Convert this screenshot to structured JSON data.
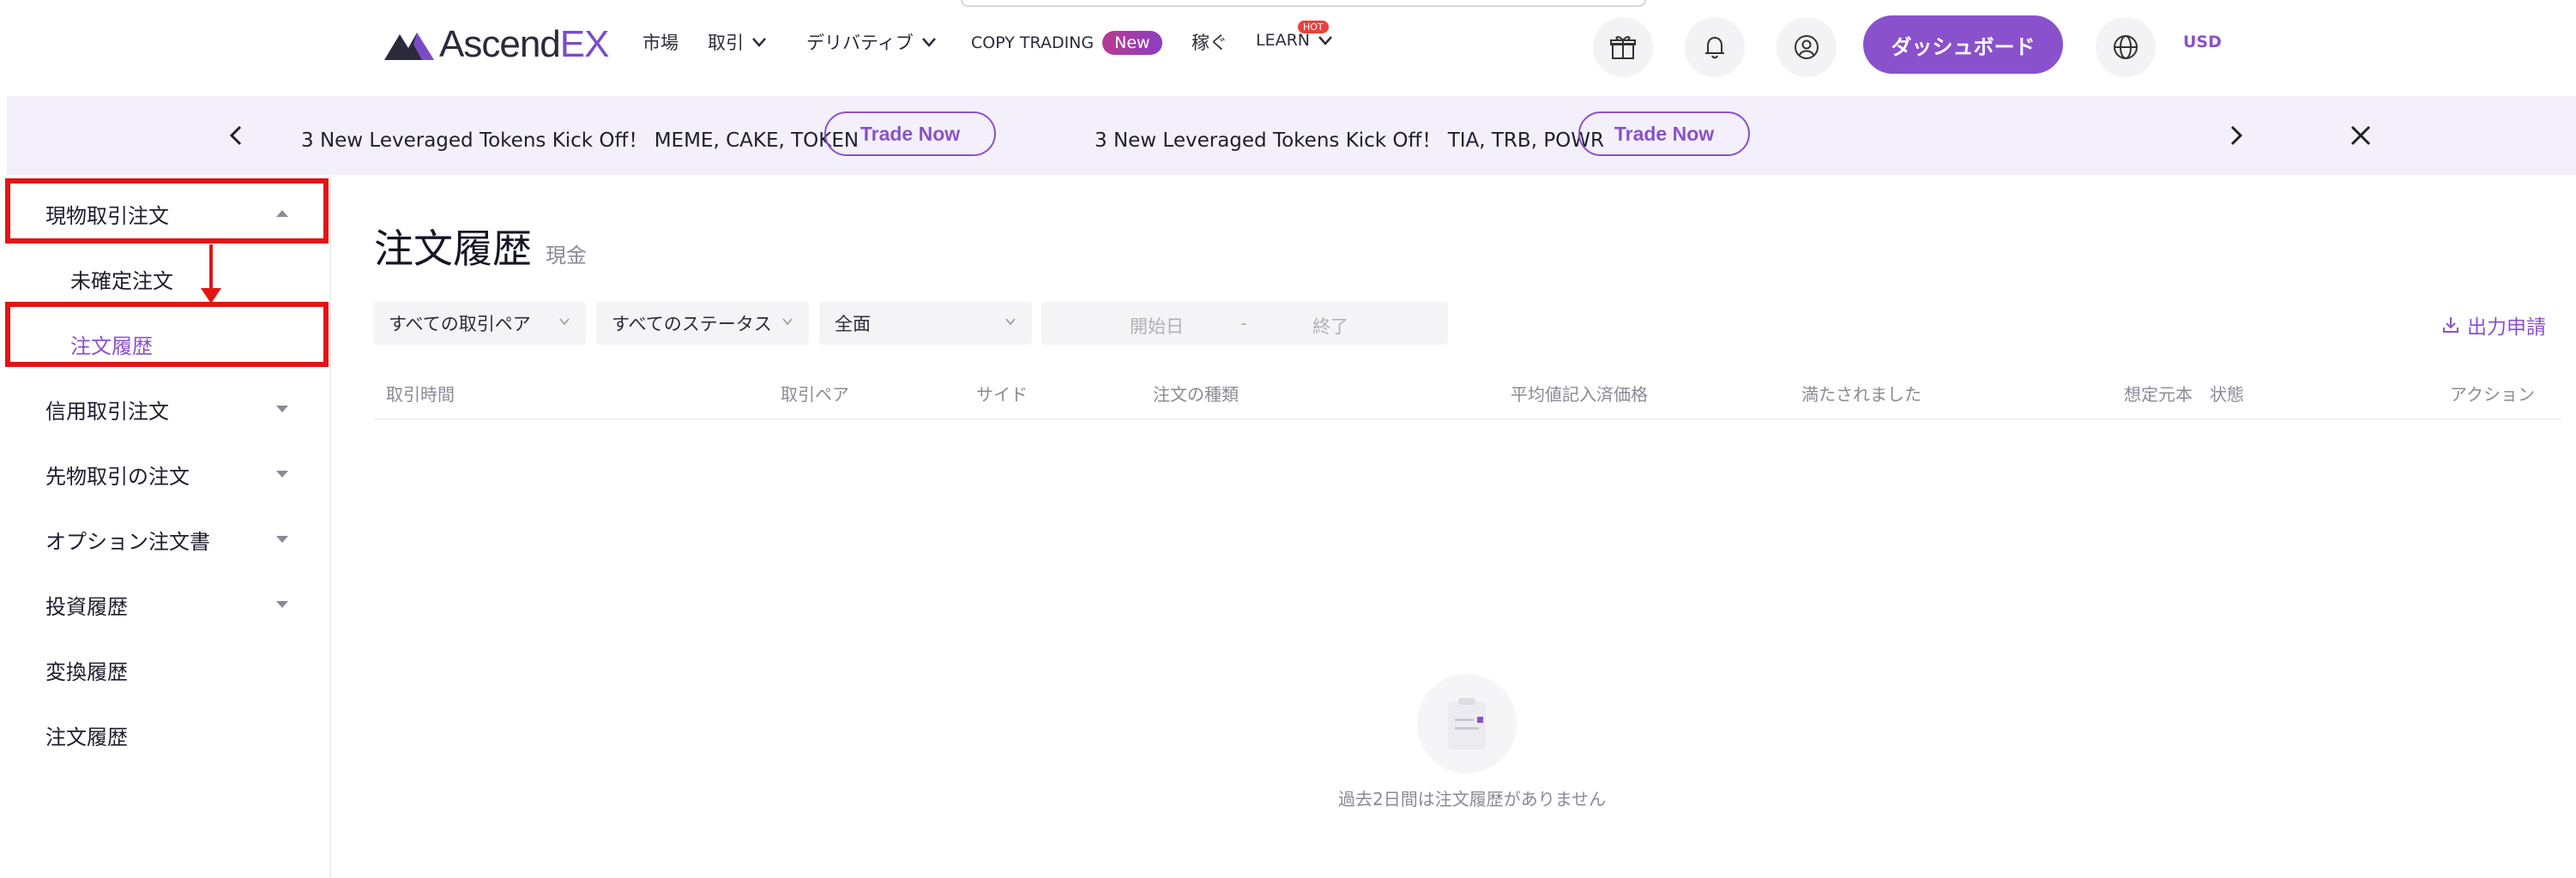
{
  "header": {
    "logo_text_main": "Ascend",
    "logo_text_accent": "EX",
    "nav": {
      "market": "市場",
      "trade": "取引",
      "derivatives": "デリバティブ",
      "copy_trading": "COPY TRADING",
      "new_badge": "New",
      "earn": "稼ぐ",
      "learn": "LEARN",
      "hot_badge": "HOT"
    },
    "dashboard_button": "ダッシュボード",
    "currency": "USD"
  },
  "banner": {
    "promo1": "3 New Leveraged Tokens Kick Off！ MEME, CAKE, TOKEN",
    "promo2": "3 New Leveraged Tokens Kick Off！ TIA, TRB, POWR",
    "trade_now": "Trade Now"
  },
  "sidebar": {
    "items": [
      {
        "label": "現物取引注文"
      },
      {
        "label": "未確定注文"
      },
      {
        "label": "注文履歴"
      },
      {
        "label": "信用取引注文"
      },
      {
        "label": "先物取引の注文"
      },
      {
        "label": "オプション注文書"
      },
      {
        "label": "投資履歴"
      },
      {
        "label": "変換履歴"
      },
      {
        "label": "注文履歴"
      }
    ]
  },
  "main": {
    "title": "注文履歴",
    "subtitle": "現金",
    "filters": {
      "pair": "すべての取引ペア",
      "status": "すべてのステータス",
      "side": "全面",
      "start_date": "開始日",
      "separator": "-",
      "end_date": "終了"
    },
    "export": "出力申請",
    "columns": [
      "取引時間",
      "取引ペア",
      "サイド",
      "注文の種類",
      "平均値記入済価格",
      "満たされました",
      "想定元本",
      "状態",
      "アクション"
    ],
    "empty_text": "過去2日間は注文履歴がありません"
  },
  "colors": {
    "accent": "#8a51cc",
    "highlight": "#e41414",
    "banner_bg": "#f3f0fb"
  }
}
